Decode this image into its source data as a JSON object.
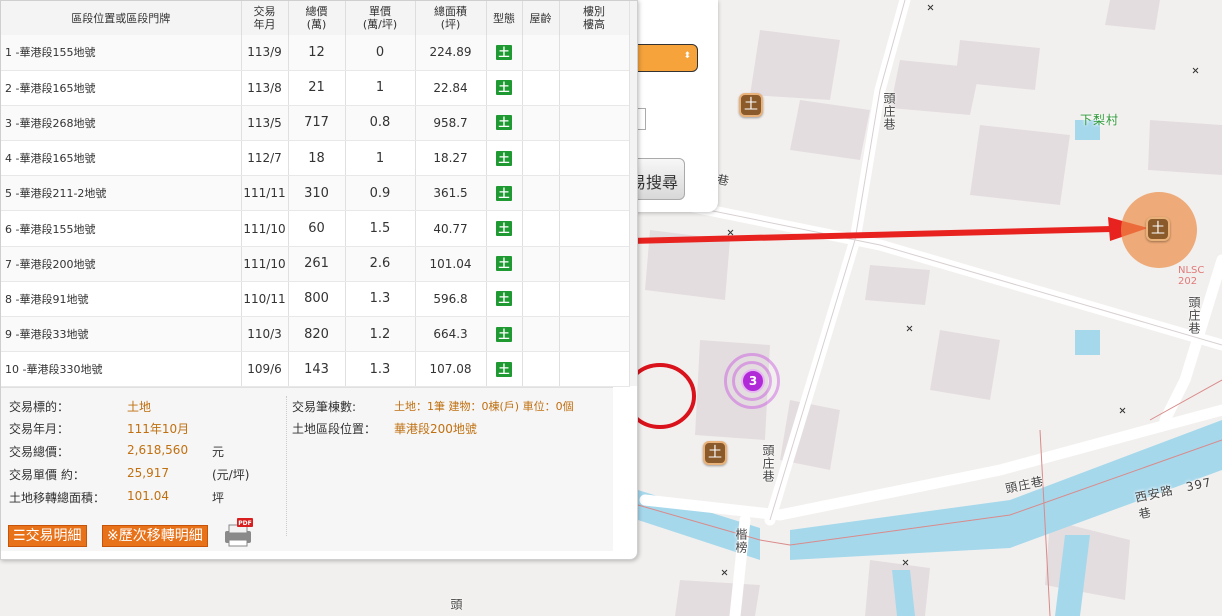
{
  "table": {
    "headers": [
      {
        "id": "address",
        "label": "區段位置或區段門牌"
      },
      {
        "id": "date",
        "label": "交易\n年月"
      },
      {
        "id": "total",
        "label": "總價\n(萬)"
      },
      {
        "id": "unit",
        "label": "單價\n(萬/坪)"
      },
      {
        "id": "area",
        "label": "總面積\n(坪)"
      },
      {
        "id": "type",
        "label": "型態"
      },
      {
        "id": "age",
        "label": "屋齡"
      },
      {
        "id": "floor",
        "label": "樓別\n樓高"
      }
    ],
    "rows": [
      {
        "addr": "1  -華港段155地號",
        "date": "113/9",
        "total": "12",
        "unit": "0",
        "area": "224.89",
        "type": "土",
        "age": "",
        "floor": ""
      },
      {
        "addr": "2  -華港段165地號",
        "date": "113/8",
        "total": "21",
        "unit": "1",
        "area": "22.84",
        "type": "土",
        "age": "",
        "floor": ""
      },
      {
        "addr": "3  -華港段268地號",
        "date": "113/5",
        "total": "717",
        "unit": "0.8",
        "area": "958.7",
        "type": "土",
        "age": "",
        "floor": ""
      },
      {
        "addr": "4  -華港段165地號",
        "date": "112/7",
        "total": "18",
        "unit": "1",
        "area": "18.27",
        "type": "土",
        "age": "",
        "floor": ""
      },
      {
        "addr": "5  -華港段211-2地號",
        "date": "111/11",
        "total": "310",
        "unit": "0.9",
        "area": "361.5",
        "type": "土",
        "age": "",
        "floor": ""
      },
      {
        "addr": "6  -華港段155地號",
        "date": "111/10",
        "total": "60",
        "unit": "1.5",
        "area": "40.77",
        "type": "土",
        "age": "",
        "floor": ""
      },
      {
        "addr": "7  -華港段200地號",
        "date": "111/10",
        "total": "261",
        "unit": "2.6",
        "area": "101.04",
        "type": "土",
        "age": "",
        "floor": ""
      },
      {
        "addr": "8  -華港段91地號",
        "date": "110/11",
        "total": "800",
        "unit": "1.3",
        "area": "596.8",
        "type": "土",
        "age": "",
        "floor": ""
      },
      {
        "addr": "9  -華港段33地號",
        "date": "110/3",
        "total": "820",
        "unit": "1.2",
        "area": "664.3",
        "type": "土",
        "age": "",
        "floor": ""
      },
      {
        "addr": "10  -華港段330地號",
        "date": "109/6",
        "total": "143",
        "unit": "1.3",
        "area": "107.08",
        "type": "土",
        "age": "",
        "floor": ""
      }
    ],
    "selected_index": 6
  },
  "detail": {
    "target_label": "交易標的：",
    "target_value": "土地",
    "date_label": "交易年月：",
    "date_value": "111年10月",
    "total_label": "交易總價：",
    "total_value": "2,618,560",
    "total_unit": "元",
    "unit_label": "交易單價 約：",
    "unit_value": "25,917",
    "unit_unit": "(元/坪)",
    "area_label": "土地移轉總面積：",
    "area_value": "101.04",
    "area_unit": "坪",
    "count_label": "交易筆棟數:",
    "count_value": "土地：1筆 建物：0棟(戶) 車位：0個",
    "location_label": "土地區段位置：",
    "location_value": "華港段200地號",
    "btn_detail": "交易明細",
    "btn_history": "※歷次移轉明細",
    "pdf_label": "PDF"
  },
  "search_panel": {
    "button_label": "易搜尋"
  },
  "map": {
    "labels": {
      "road_touzhuang_top": "頭庄巷",
      "road_touzhuang_mid": "頭庄巷",
      "road_touzhuang_right": "頭庄巷",
      "road_touzhuang_h": "頭庄巷",
      "road_zhuang": "庄巷",
      "road_xian": "西安路　397巷",
      "road_jie": "楷榜",
      "village": "下梨村",
      "tou": "頭",
      "xia_road": "庄巷",
      "nlsc": "NLSC 202",
      "cluster_count": "3",
      "land_glyph": "土"
    },
    "colors": {
      "water": "#a6d8ec",
      "road": "#ffffff",
      "building": "#e4dde0",
      "arrow": "#e8231f",
      "circle": "#d9121b"
    }
  }
}
